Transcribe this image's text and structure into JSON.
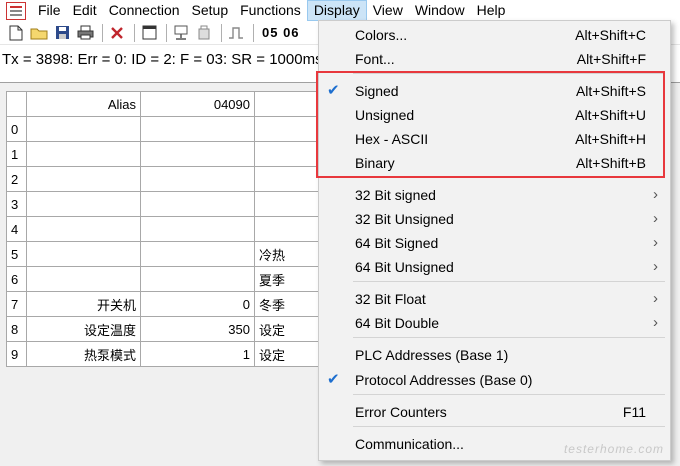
{
  "menubar": {
    "items": [
      "File",
      "Edit",
      "Connection",
      "Setup",
      "Functions",
      "Display",
      "View",
      "Window",
      "Help"
    ]
  },
  "toolbar": {
    "text": "05 06"
  },
  "status": {
    "text": "Tx = 3898: Err = 0: ID = 2: F = 03: SR = 1000ms"
  },
  "grid": {
    "header": {
      "alias": "Alias",
      "value": "04090"
    },
    "rows": [
      {
        "idx": "0",
        "alias": "",
        "value": "",
        "extra": ""
      },
      {
        "idx": "1",
        "alias": "",
        "value": "",
        "extra": ""
      },
      {
        "idx": "2",
        "alias": "",
        "value": "",
        "extra": ""
      },
      {
        "idx": "3",
        "alias": "",
        "value": "",
        "extra": ""
      },
      {
        "idx": "4",
        "alias": "",
        "value": "",
        "extra": ""
      },
      {
        "idx": "5",
        "alias": "",
        "value": "",
        "extra": "冷热"
      },
      {
        "idx": "6",
        "alias": "",
        "value": "",
        "extra": "夏季"
      },
      {
        "idx": "7",
        "alias": "开关机",
        "value": "0",
        "extra": "冬季"
      },
      {
        "idx": "8",
        "alias": "设定温度",
        "value": "350",
        "extra": "设定"
      },
      {
        "idx": "9",
        "alias": "热泵模式",
        "value": "1",
        "extra": "设定"
      }
    ]
  },
  "display_menu": {
    "items": [
      {
        "label": "Colors...",
        "shortcut": "Alt+Shift+C",
        "checked": false,
        "submenu": false
      },
      {
        "label": "Font...",
        "shortcut": "Alt+Shift+F",
        "checked": false,
        "submenu": false
      },
      {
        "label": "Signed",
        "shortcut": "Alt+Shift+S",
        "checked": true,
        "submenu": false
      },
      {
        "label": "Unsigned",
        "shortcut": "Alt+Shift+U",
        "checked": false,
        "submenu": false
      },
      {
        "label": "Hex - ASCII",
        "shortcut": "Alt+Shift+H",
        "checked": false,
        "submenu": false
      },
      {
        "label": "Binary",
        "shortcut": "Alt+Shift+B",
        "checked": false,
        "submenu": false
      },
      {
        "label": "32 Bit signed",
        "shortcut": "",
        "checked": false,
        "submenu": true
      },
      {
        "label": "32 Bit Unsigned",
        "shortcut": "",
        "checked": false,
        "submenu": true
      },
      {
        "label": "64 Bit Signed",
        "shortcut": "",
        "checked": false,
        "submenu": true
      },
      {
        "label": "64 Bit Unsigned",
        "shortcut": "",
        "checked": false,
        "submenu": true
      },
      {
        "label": "32 Bit Float",
        "shortcut": "",
        "checked": false,
        "submenu": true
      },
      {
        "label": "64 Bit Double",
        "shortcut": "",
        "checked": false,
        "submenu": true
      },
      {
        "label": "PLC Addresses (Base 1)",
        "shortcut": "",
        "checked": false,
        "submenu": false
      },
      {
        "label": "Protocol Addresses (Base 0)",
        "shortcut": "",
        "checked": true,
        "submenu": false
      },
      {
        "label": "Error Counters",
        "shortcut": "F11",
        "checked": false,
        "submenu": false
      },
      {
        "label": "Communication...",
        "shortcut": "",
        "checked": false,
        "submenu": false
      }
    ],
    "check_glyph": "✔",
    "arrow_glyph": "›"
  },
  "watermark": "testerhome.com",
  "colors": {
    "highlight_border": "#e8383d",
    "menu_active": "#cce4f7",
    "check": "#1e6fcf"
  }
}
